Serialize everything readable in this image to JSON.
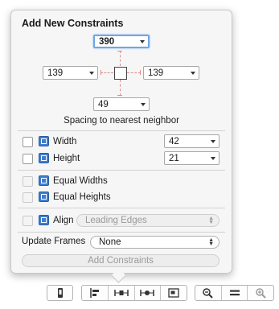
{
  "popover": {
    "title": "Add New Constraints",
    "spacing": {
      "top": "390",
      "left": "139",
      "right": "139",
      "bottom": "49",
      "caption": "Spacing to nearest neighbor"
    },
    "size": {
      "width_label": "Width",
      "width_value": "42",
      "height_label": "Height",
      "height_value": "21"
    },
    "equal": {
      "widths_label": "Equal Widths",
      "heights_label": "Equal Heights"
    },
    "align": {
      "label": "Align",
      "value": "Leading Edges"
    },
    "update_frames": {
      "label": "Update Frames",
      "value": "None"
    },
    "add_button": "Add Constraints"
  },
  "toolbar": {
    "icons": [
      "device-icon",
      "align-icon",
      "pin-icon",
      "resolve-icon",
      "resize-icon",
      "zoom-out-icon",
      "zoom-actual-icon",
      "zoom-in-icon"
    ]
  },
  "colors": {
    "accent": "#3f7fd0",
    "focus_ring": "#6ea6e6",
    "guide": "#e08a8a"
  }
}
